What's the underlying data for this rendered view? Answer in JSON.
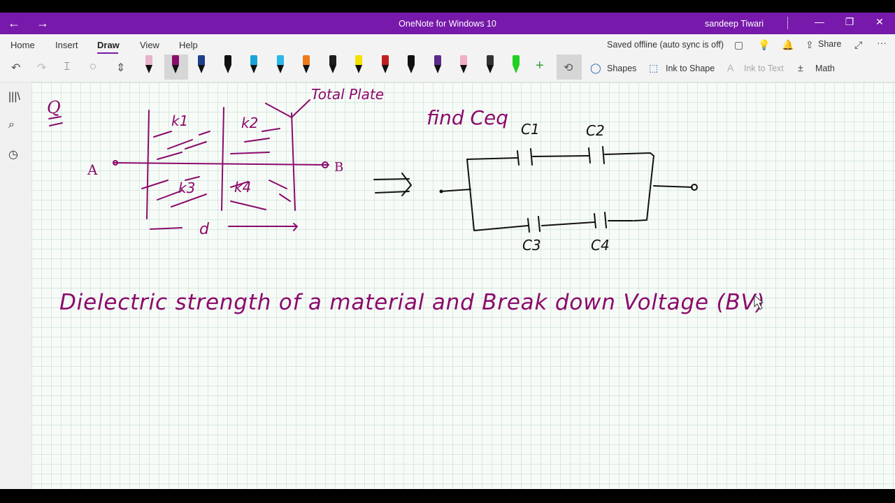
{
  "window": {
    "title": "OneNote for Windows 10",
    "user": "sandeep Tiwari",
    "back_glyph": "←",
    "forward_glyph": "→",
    "minimize_glyph": "—",
    "restore_glyph": "❐",
    "close_glyph": "✕"
  },
  "menu": {
    "tabs": [
      "Home",
      "Insert",
      "Draw",
      "View",
      "Help"
    ],
    "active_tab": "Draw",
    "status": "Saved offline (auto sync is off)",
    "share_label": "Share",
    "more_glyph": "···"
  },
  "toolbar": {
    "shapes_label": "Shapes",
    "ink_to_shape_label": "Ink to Shape",
    "ink_to_text_label": "Ink to Text",
    "math_label": "Math",
    "pens": [
      {
        "color": "#e6b3c9"
      },
      {
        "color": "#8a0f6c"
      },
      {
        "color": "#1f3f8a"
      },
      {
        "color": "#111111"
      },
      {
        "color": "#1aa3d9"
      },
      {
        "color": "#2bb7e8"
      },
      {
        "color": "#f07a1a"
      },
      {
        "color": "#1f1f1f"
      },
      {
        "color": "#f4e000"
      },
      {
        "color": "#c01f1f"
      },
      {
        "color": "#111111"
      },
      {
        "color": "#5b2a8c"
      },
      {
        "color": "#f0b0c8"
      },
      {
        "color": "#333333"
      },
      {
        "color": "#21d021"
      }
    ]
  },
  "colors": {
    "accent": "#7719aa",
    "ink_magenta": "#8b0a6c",
    "ink_black": "#111111"
  },
  "note": {
    "question_mark": "Q",
    "label_k1": "k1",
    "label_k2": "k2",
    "label_k3": "k3",
    "label_k4": "k4",
    "label_A": "A",
    "label_B": "B",
    "label_d": "d",
    "label_total": "Total Plate",
    "find_text": "find Ceq",
    "cap_c1": "C1",
    "cap_c2": "C2",
    "cap_c3": "C3",
    "cap_c4": "C4",
    "heading": "Dielectric strength of a material and Break down Voltage (BV)"
  }
}
